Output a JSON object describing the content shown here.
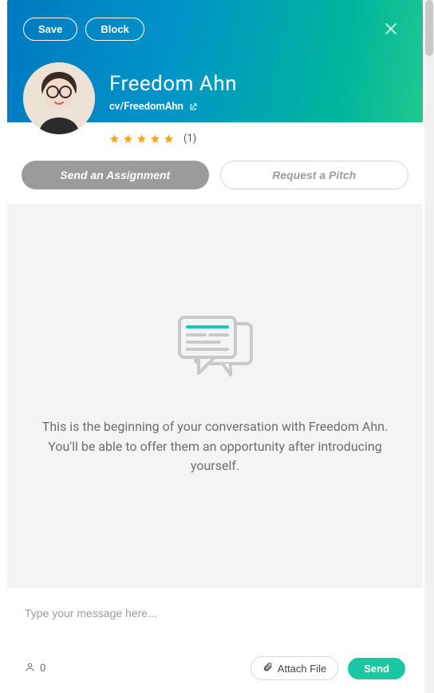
{
  "header": {
    "save_label": "Save",
    "block_label": "Block",
    "name": "Freedom Ahn",
    "handle": "cv/FreedomAhn",
    "rating_count": "(1)",
    "stars": 5
  },
  "actions": {
    "assign_label": "Send an Assignment",
    "pitch_label": "Request a Pitch"
  },
  "conversation": {
    "empty_text": "This is the beginning of your conversation with Freedom Ahn. You'll be able to offer them an opportunity after introducing yourself."
  },
  "composer": {
    "placeholder": "Type your message here...",
    "recipient_count": "0",
    "attach_label": "Attach File",
    "send_label": "Send"
  }
}
